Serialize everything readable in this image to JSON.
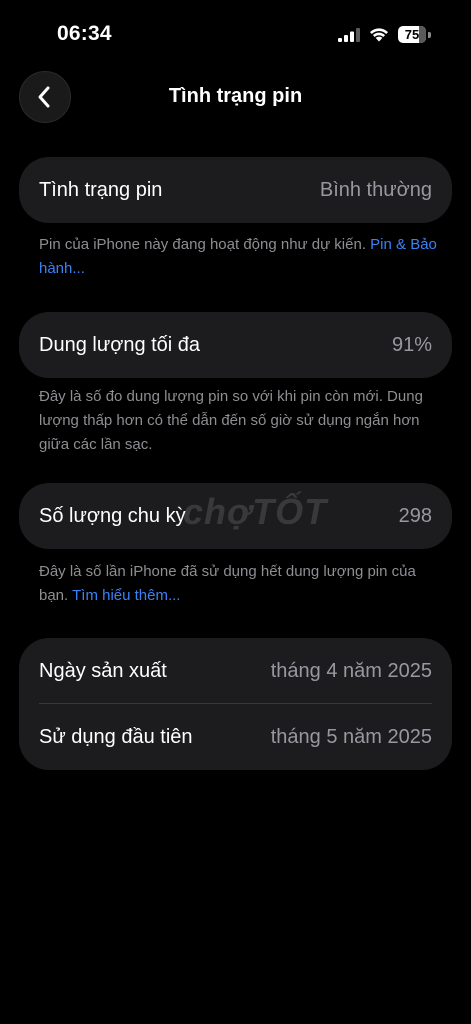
{
  "status_bar": {
    "time": "06:34",
    "battery_level": "75",
    "battery_fraction": 0.75,
    "icons": [
      "cellular-signal-icon",
      "wifi-icon",
      "battery-icon"
    ]
  },
  "nav": {
    "title": "Tình trạng pin",
    "back_icon": "chevron-left-icon"
  },
  "battery_health": {
    "label": "Tình trạng pin",
    "value": "Bình thường",
    "footnote_text": "Pin của iPhone này đang hoạt động như dự kiến.",
    "footnote_link": "Pin & Bảo hành..."
  },
  "maximum_capacity": {
    "label": "Dung lượng tối đa",
    "value": "91%",
    "footnote_text": "Đây là số đo dung lượng pin so với khi pin còn mới. Dung lượng thấp hơn có thể dẫn đến số giờ sử dụng ngắn hơn giữa các lần sạc."
  },
  "cycle_count": {
    "label": "Số lượng chu kỳ",
    "value": "298",
    "footnote_text": "Đây là số lần iPhone đã sử dụng hết dung lượng pin của bạn.",
    "footnote_link": "Tìm hiểu thêm..."
  },
  "dates": {
    "manufacture_label": "Ngày sản xuất",
    "manufacture_value": "tháng 4 năm 2025",
    "first_use_label": "Sử dụng đầu tiên",
    "first_use_value": "tháng 5 năm 2025"
  },
  "watermark": "chợTỐT",
  "colors": {
    "background": "#000000",
    "card": "#1c1c1e",
    "secondary_text": "#98989f",
    "footnote": "#8e8e93",
    "link": "#3b82f6"
  }
}
